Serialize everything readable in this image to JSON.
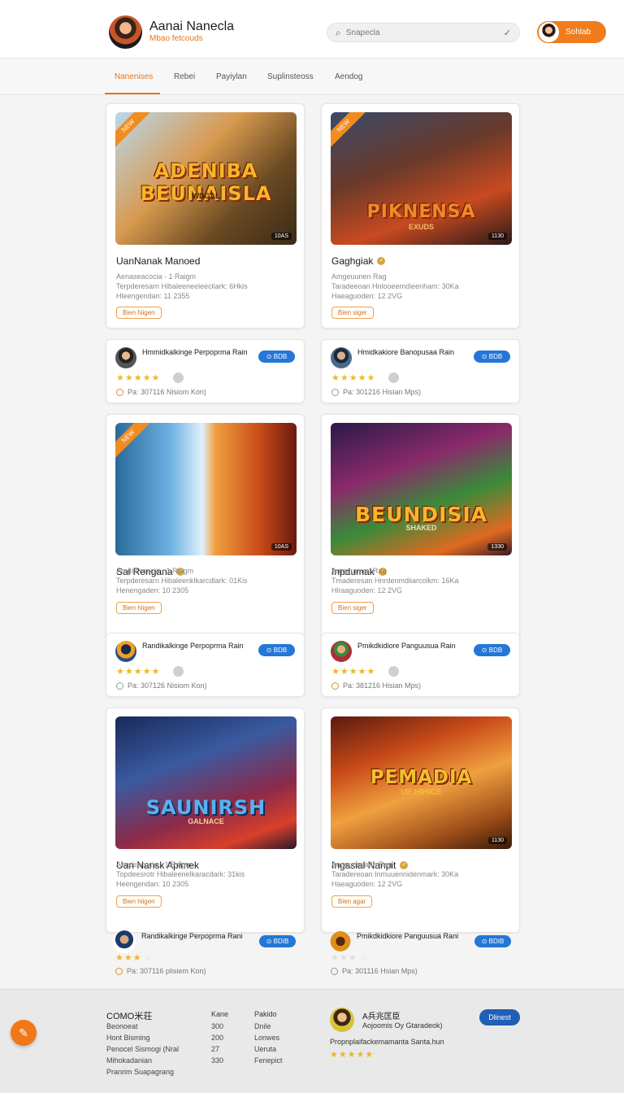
{
  "header": {
    "brand_title": "Aanai Nanecla",
    "brand_subtitle": "Mbao fetcouds",
    "search_placeholder": "Snapecla",
    "signin_label": "Sohlab"
  },
  "tabs": [
    {
      "label": "Nanenises",
      "active": true
    },
    {
      "label": "Rebei"
    },
    {
      "label": "Payiylan"
    },
    {
      "label": "Suplinsteoss"
    },
    {
      "label": "Aendog"
    }
  ],
  "games": [
    {
      "title": "UanNanak Manoed",
      "verified": false,
      "ribbon": "NEW",
      "logo": "ADENIBA BEUNAISLA",
      "logo_sub": "WDGAL",
      "badge": "10AS",
      "meta1": "Aenaseacocia · 1 Raigm",
      "meta2": "Terpderesarn Hibaleeneeleecliark: 6Hkis",
      "meta3": "Hleengendan: 11 2355",
      "play": "Bien hiigen"
    },
    {
      "title": "Gaghgiak",
      "verified": true,
      "ribbon": "NEW",
      "logo": "PIKNENSA",
      "logo_sub": "EXUDS",
      "badge": "1130",
      "meta1": "Amgeuunen Rag",
      "meta2": "Taradeeoan Hnlooeemdieenham: 30Ka",
      "meta3": "Haeaguoden: 12 2VG",
      "play": "Bien siger"
    },
    {
      "title": "Sai Rengana",
      "verified": true,
      "ribbon": "NEW",
      "logo": "",
      "logo_sub": "",
      "badge": "10AS",
      "meta1": "Amdsoscacia · 1 Raigm",
      "meta2": "Terpderesarn Hibaleenklkarcdlark: 01Kis",
      "meta3": "Henengaden: 10 2305",
      "play": "Bien hiigen"
    },
    {
      "title": "Inpdumak",
      "verified": true,
      "ribbon": "",
      "logo": "BEUNDISIA",
      "logo_sub": "SHAKED",
      "badge": "1330",
      "meta1": "Amgeuunen Rag",
      "meta2": "Tmaderesan Hnrdenmdiiarcolkm: 16Ka",
      "meta3": "Hlraaguoden: 12 2VG",
      "play": "Bien siger"
    },
    {
      "title": "Uan Nansk Apimek",
      "verified": false,
      "ribbon": "",
      "logo": "SAUNIRSH",
      "logo_sub": "GALNACE",
      "badge": "",
      "meta1": "Aendsecocia · 1 Raigm",
      "meta2": "Topdeesrotr Hibaleenelkaracdark: 31kis",
      "meta3": "Heengendan: 10 2305",
      "play": "Bien hiigen"
    },
    {
      "title": "Ingasial Nanpit",
      "verified": true,
      "ribbon": "",
      "logo": "PEMADIA",
      "logo_sub": "UE HIHICE",
      "badge": "1130",
      "meta1": "Angeuonsadn Rag",
      "meta2": "Taradereoan Inmuuennidenmark: 30Ka",
      "meta3": "Haeaguoden: 12 2VG",
      "play": "Bien agar"
    }
  ],
  "developers": [
    {
      "name": "Hmmidkalkinge Perpoprma Rain",
      "button": "BDB",
      "stars": 5,
      "info": "Pa: 307116 Nisiom Kon)"
    },
    {
      "name": "Hmidkakiore Banopusaa Rain",
      "button": "BDB",
      "stars": 5,
      "info": "Pa: 301216 Hisian Mps)"
    },
    {
      "name": "Randikalkinge Perpoprma Rain",
      "button": "BDB",
      "stars": 5,
      "info": "Pa: 307126 Nisiom Kon)"
    },
    {
      "name": "Pmikdkidiore Panguusua Rain",
      "button": "BDB",
      "stars": 5,
      "info": "Pa: 381216 Hisian Mps)"
    },
    {
      "name": "Randikalkinge Perpoprma Rani",
      "button": "BDIB",
      "stars": 3,
      "info": "Pa: 307116 plisiem Kon)"
    },
    {
      "name": "Pmikdkidkiore Panguusua Rani",
      "button": "BDIB",
      "stars": 0,
      "info": "Pa: 301116 Hsian Mps)"
    }
  ],
  "footer": {
    "title": "COMO⽶荘",
    "col1": [
      "Beonoeat",
      "Hont Bisming",
      "Penocel Sismogi (Nral",
      "Mihokadanian",
      "Pranrim Suapagrang"
    ],
    "col2_head": "Kane",
    "col2": [
      "300",
      "200",
      "27",
      "330"
    ],
    "col3_head": "Pakido",
    "col3": [
      "Dnile",
      "Lonwes",
      "Ueruta",
      "Fenepict"
    ],
    "user_name": "A兵兆匡⾂",
    "user_handle": "Aojoomis Oy Gtaradeok)",
    "follow_label": "Dlinest",
    "caption": "Propnplaifackemamanta Santa.hun",
    "stars": 5
  },
  "colors": {
    "accent": "#f07c1c",
    "blue": "#2477d6",
    "star": "#f2b620"
  }
}
